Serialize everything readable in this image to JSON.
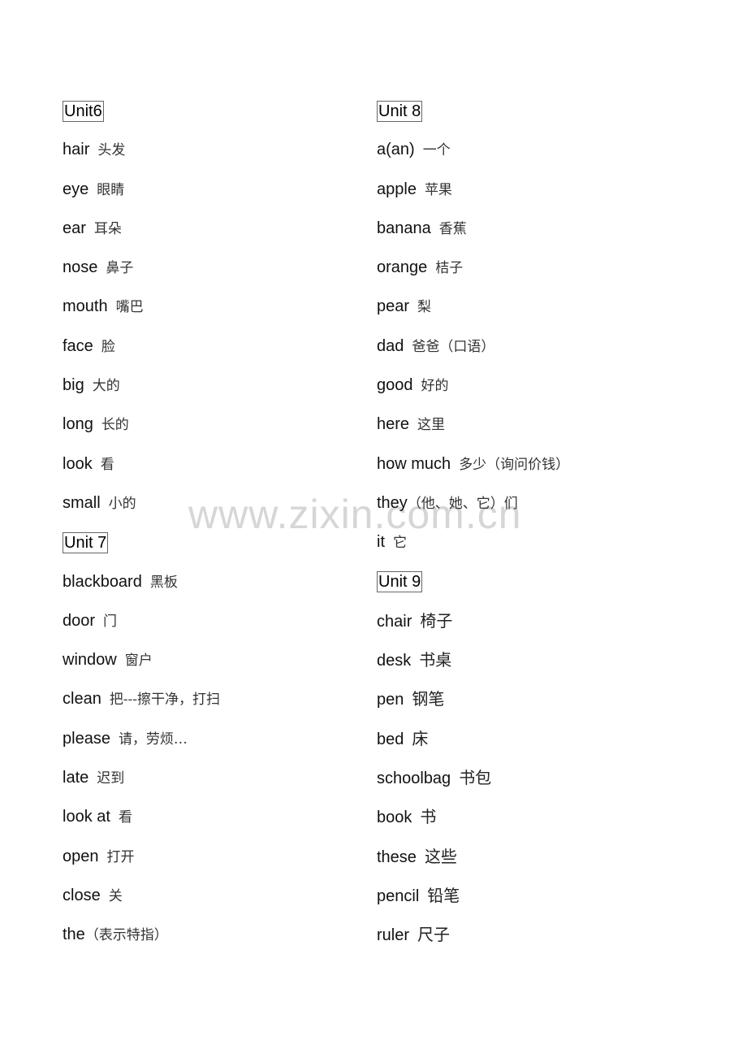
{
  "watermark": "www.zixin.com.cn",
  "left_column": [
    {
      "type": "unit",
      "label": "Unit6"
    },
    {
      "type": "word",
      "en": "hair",
      "zh": "头发"
    },
    {
      "type": "word",
      "en": "eye",
      "zh": "眼睛"
    },
    {
      "type": "word",
      "en": "ear",
      "zh": "耳朵"
    },
    {
      "type": "word",
      "en": "nose",
      "zh": "鼻子"
    },
    {
      "type": "word",
      "en": "mouth",
      "zh": "嘴巴"
    },
    {
      "type": "word",
      "en": "face",
      "zh": "脸"
    },
    {
      "type": "word",
      "en": "big",
      "zh": "大的"
    },
    {
      "type": "word",
      "en": "long",
      "zh": "长的"
    },
    {
      "type": "word",
      "en": "look",
      "zh": "看"
    },
    {
      "type": "word",
      "en": "small",
      "zh": "小的"
    },
    {
      "type": "unit",
      "label": "Unit 7"
    },
    {
      "type": "word",
      "en": "blackboard",
      "zh": "黑板"
    },
    {
      "type": "word",
      "en": "door",
      "zh": "门"
    },
    {
      "type": "word",
      "en": "window",
      "zh": "窗户"
    },
    {
      "type": "word",
      "en": "clean",
      "zh": "把---擦干净，打扫"
    },
    {
      "type": "word",
      "en": "please",
      "zh": "请，劳烦…"
    },
    {
      "type": "word",
      "en": "late",
      "zh": "迟到"
    },
    {
      "type": "word",
      "en": "look at",
      "zh": "看"
    },
    {
      "type": "word",
      "en": "open",
      "zh": "打开"
    },
    {
      "type": "word",
      "en": "close",
      "zh": "关"
    },
    {
      "type": "word",
      "en": "the",
      "zh": "（表示特指）"
    }
  ],
  "right_column": [
    {
      "type": "unit",
      "label": "Unit 8"
    },
    {
      "type": "word",
      "en": "a(an)",
      "zh": "一个"
    },
    {
      "type": "word",
      "en": "apple",
      "zh": "苹果"
    },
    {
      "type": "word",
      "en": "banana",
      "zh": "香蕉"
    },
    {
      "type": "word",
      "en": "orange",
      "zh": "桔子"
    },
    {
      "type": "word",
      "en": "pear",
      "zh": "梨"
    },
    {
      "type": "word",
      "en": "dad",
      "zh": "爸爸（口语）"
    },
    {
      "type": "word",
      "en": "good",
      "zh": "好的"
    },
    {
      "type": "word",
      "en": "here",
      "zh": "这里"
    },
    {
      "type": "word",
      "en": "how much",
      "zh": "多少（询问价钱）"
    },
    {
      "type": "word",
      "en": "they",
      "zh": "（他、她、它）们"
    },
    {
      "type": "word",
      "en": "it",
      "zh": "它"
    },
    {
      "type": "unit",
      "label": "Unit 9"
    },
    {
      "type": "word",
      "en": "chair",
      "zh": "椅子"
    },
    {
      "type": "word",
      "en": "desk",
      "zh": "书桌"
    },
    {
      "type": "word",
      "en": "pen",
      "zh": "钢笔"
    },
    {
      "type": "word",
      "en": "bed",
      "zh": "床"
    },
    {
      "type": "word",
      "en": "schoolbag",
      "zh": "书包"
    },
    {
      "type": "word",
      "en": "book",
      "zh": "书"
    },
    {
      "type": "word",
      "en": "these",
      "zh": "这些"
    },
    {
      "type": "word",
      "en": "pencil",
      "zh": "铅笔"
    },
    {
      "type": "word",
      "en": "ruler",
      "zh": "尺子"
    }
  ]
}
